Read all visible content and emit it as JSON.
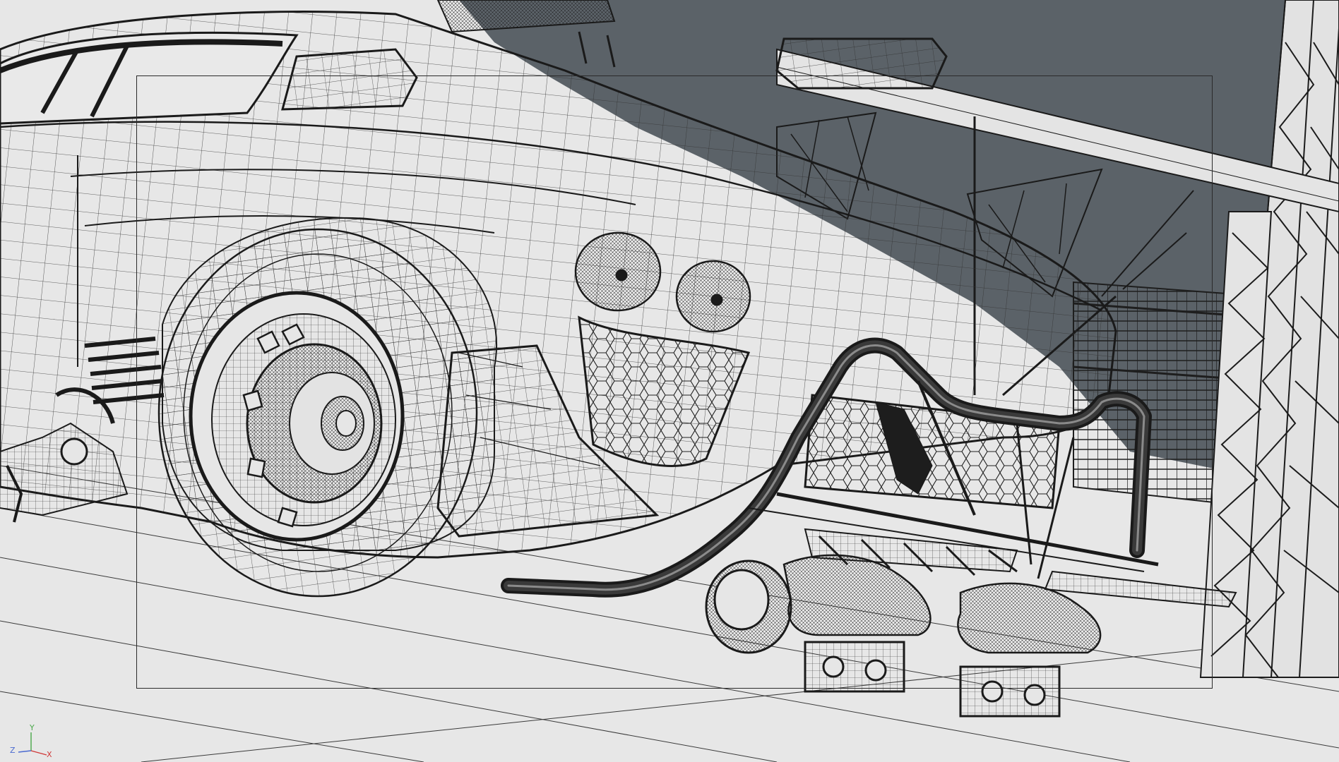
{
  "viewport": {
    "mode": "wireframe",
    "background_color": "#e7e7e7",
    "sky_color": "#5b6268",
    "wire_color": "#1b1b1b"
  },
  "safe_frame": {
    "visible": true
  },
  "axis_gizmo": {
    "x_label": "X",
    "y_label": "Y",
    "z_label": "Z",
    "x_color": "#d03a3a",
    "y_color": "#4aa84a",
    "z_color": "#4a6ad0"
  }
}
